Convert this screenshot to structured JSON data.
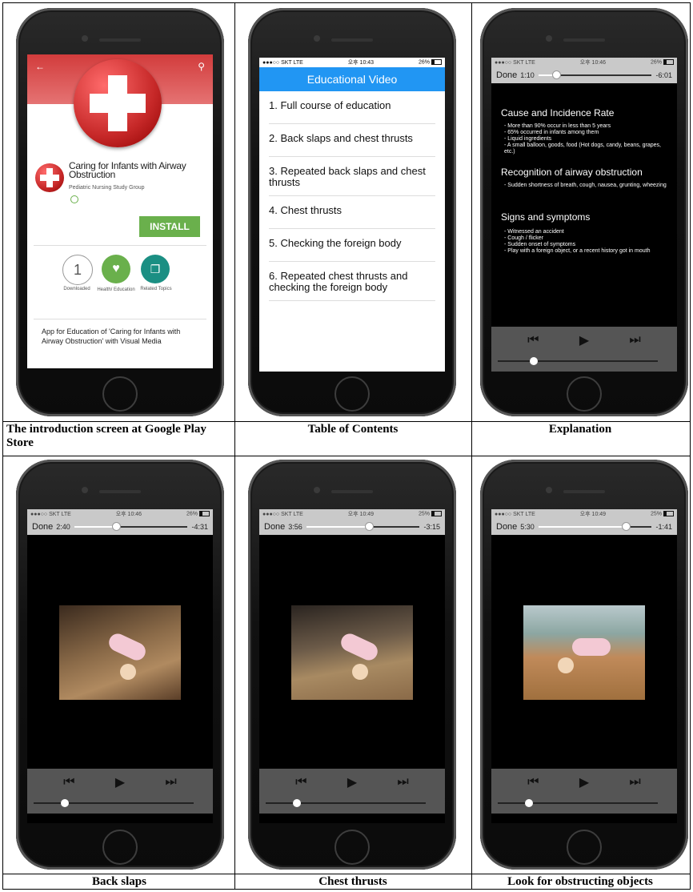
{
  "captions": {
    "c1": "The introduction screen at Google Play Store",
    "c2": "Table of Contents",
    "c3": "Explanation",
    "c4": "Back slaps",
    "c5": "Chest thrusts",
    "c6": "Look for obstructing objects"
  },
  "store": {
    "app_title": "Caring for Infants with Airway Obstruction",
    "developer": "Pediatric Nursing Study Group",
    "install_label": "INSTALL",
    "downloads_count": "1",
    "downloaded_label": "Downloaded",
    "category_label": "Health/ Education",
    "related_label": "Related Topics",
    "description": "App for Education of 'Caring for Infants with Airway Obstruction' with Visual Media",
    "colors": {
      "install": "#6ab04c",
      "red": "#d32f2f"
    }
  },
  "toc": {
    "status_left": "●●●○○ SKT  LTE",
    "status_time": "오후 10:43",
    "status_battery": "26%",
    "header": "Educational Video",
    "items": [
      "1. Full course of  education",
      "2. Back slaps and chest thrusts",
      "3. Repeated back slaps and chest thrusts",
      "4. Chest thrusts",
      "5. Checking the foreign body",
      "6. Repeated chest thrusts and checking the foreign body"
    ],
    "header_color": "#2196f3"
  },
  "explain": {
    "status_left": "●●●○○ SKT  LTE",
    "status_time": "오후 10:46",
    "status_battery": "26%",
    "done": "Done",
    "elapsed": "1:10",
    "remaining": "-6:01",
    "progress": 0.16,
    "s1_title": "Cause and Incidence Rate",
    "s1_lines": [
      "- More than 90% occur in less than 5 years",
      "- 65% occurred in infants among them",
      "- Liquid ingredients",
      "- A small balloon, goods, food (Hot dogs, candy, beans, grapes, etc.)"
    ],
    "s2_title": "Recognition of airway obstruction",
    "s2_lines": [
      "- Sudden shortness of breath, cough, nausea, grunting, wheezing"
    ],
    "s3_title": "Signs and symptoms",
    "s3_lines": [
      "- Witnessed an accident",
      "- Cough / flicker",
      "- Sudden onset of symptoms",
      "- Play with a foreign object, or a recent history got in mouth"
    ]
  },
  "videos": [
    {
      "status_left": "●●●○○ SKT  LTE",
      "status_time": "오후 10:46",
      "status_battery": "26%",
      "done": "Done",
      "elapsed": "2:40",
      "remaining": "-4:31",
      "progress": 0.37
    },
    {
      "status_left": "●●●○○ SKT  LTE",
      "status_time": "오후 10:49",
      "status_battery": "25%",
      "done": "Done",
      "elapsed": "3:56",
      "remaining": "-3:15",
      "progress": 0.55
    },
    {
      "status_left": "●●●○○ SKT  LTE",
      "status_time": "오후 10:49",
      "status_battery": "25%",
      "done": "Done",
      "elapsed": "5:30",
      "remaining": "-1:41",
      "progress": 0.77
    }
  ],
  "icons": {
    "prev": "⏮",
    "play": "▶",
    "next": "⏭",
    "back": "←",
    "search": "⚲"
  }
}
